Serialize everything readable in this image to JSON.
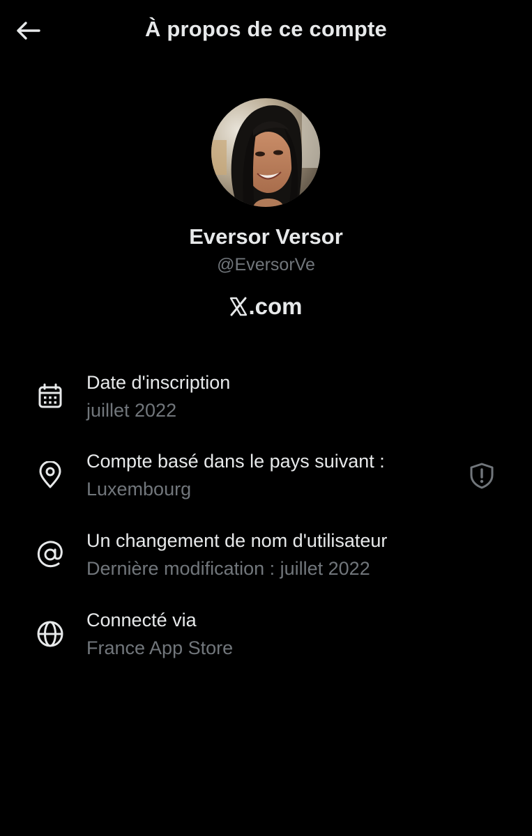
{
  "header": {
    "title": "À propos de ce compte",
    "back_icon": "arrow-left-icon"
  },
  "profile": {
    "display_name": "Eversor Versor",
    "handle": "@EversorVe",
    "domain_text": ".com",
    "domain_logo": "x-logo-icon"
  },
  "details": [
    {
      "icon": "calendar-icon",
      "label": "Date d'inscription",
      "value": "juillet 2022"
    },
    {
      "icon": "location-pin-icon",
      "label": "Compte basé dans le pays suivant :",
      "value": "Luxembourg",
      "trailing_icon": "shield-alert-icon"
    },
    {
      "icon": "at-sign-icon",
      "label": "Un changement de nom d'utilisateur",
      "value": "Dernière modification : juillet 2022"
    },
    {
      "icon": "globe-icon",
      "label": "Connecté via",
      "value": "France App Store"
    }
  ],
  "colors": {
    "background": "#000000",
    "primary_text": "#e7e9ea",
    "secondary_text": "#71767b"
  }
}
